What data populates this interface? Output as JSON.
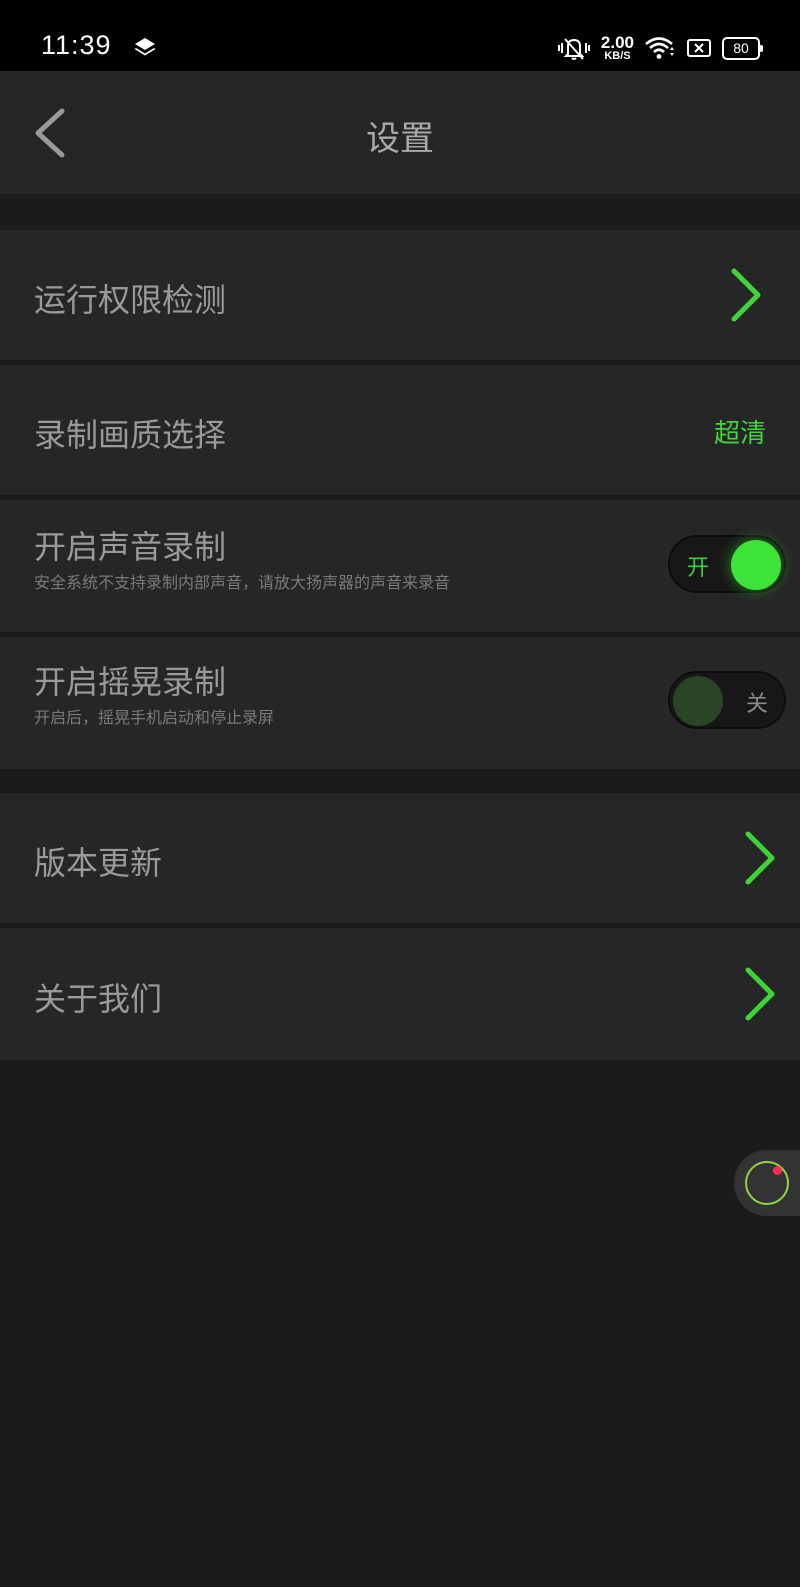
{
  "status_bar": {
    "time": "11:39",
    "net_speed_value": "2.00",
    "net_speed_unit": "KB/S",
    "battery": "80"
  },
  "header": {
    "title": "设置"
  },
  "settings": {
    "permission_check": {
      "label": "运行权限检测"
    },
    "record_quality": {
      "label": "录制画质选择",
      "value": "超清"
    },
    "sound_record": {
      "label": "开启声音录制",
      "description": "安全系统不支持录制内部声音，请放大扬声器的声音来录音",
      "toggle_label": "开",
      "enabled": true
    },
    "shake_record": {
      "label": "开启摇晃录制",
      "description": "开启后，摇晃手机启动和停止录屏",
      "toggle_label": "关",
      "enabled": false
    },
    "version_update": {
      "label": "版本更新"
    },
    "about_us": {
      "label": "关于我们"
    }
  },
  "colors": {
    "accent": "#3fd53a",
    "background": "#1b1b1b",
    "row": "#262626",
    "record_dot": "#ff2a55"
  }
}
